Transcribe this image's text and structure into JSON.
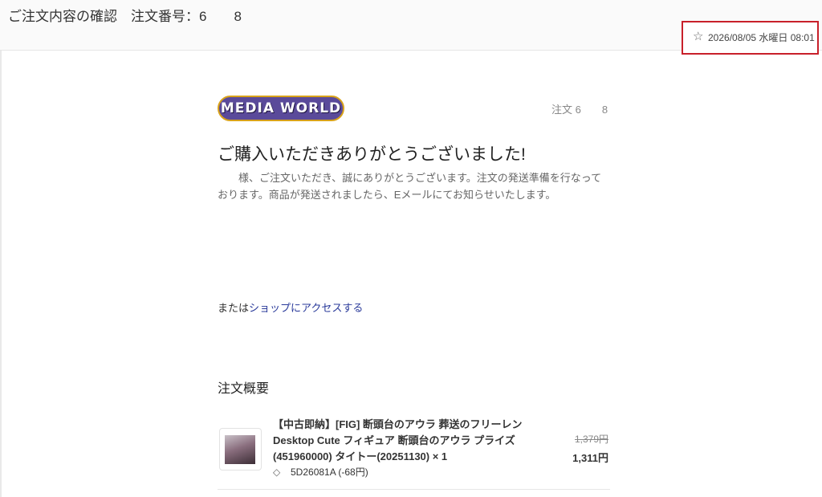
{
  "email": {
    "subject": "ご注文内容の確認　注文番号：6　　8",
    "date": "2026/08/05 水曜日 08:01"
  },
  "message": {
    "logo_text": "MEDIA WORLD",
    "order_label": "注文 6　　8",
    "headline": "ご購入いただきありがとうございました!",
    "body": "　　様、ご注文いただき、誠にありがとうございます。注文の発送準備を行なっております。商品が発送されましたら、Eメールにてお知らせいたします。",
    "shop_prefix": "または",
    "shop_link": "ショップにアクセスする"
  },
  "summary": {
    "title": "注文概要",
    "items": [
      {
        "name": "【中古即納】[FIG] 断頭台のアウラ 葬送のフリーレン Desktop Cute フィギュア 断頭台のアウラ プライズ(451960000) タイトー(20251130) × 1",
        "discount": "5D26081A (-68円)",
        "old_price": "1,379円",
        "new_price": "1,311円"
      }
    ]
  }
}
